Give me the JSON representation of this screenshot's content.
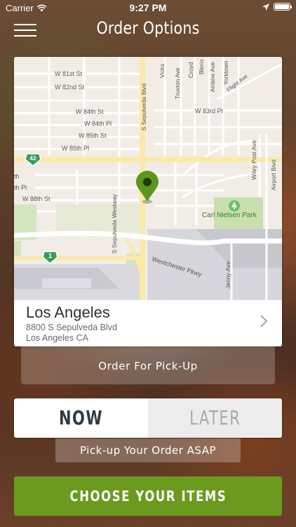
{
  "status_bar": {
    "carrier": "Carrier",
    "time": "9:27 PM"
  },
  "nav": {
    "title": "Order Options"
  },
  "map": {
    "streets": {
      "w81": "W 81st St",
      "w82": "W 82nd St",
      "w84": "W 84th St",
      "w84pl": "W 84th Pl",
      "w85": "W 85th St",
      "w85pl": "W 85th Pl",
      "w83pl": "W 83rd Pl",
      "w88": "W 88th St",
      "thpl": "th Pl",
      "th": "th",
      "sepulveda": "S Sepulveda Blvd",
      "sepulveda_westway": "S Sepulveda Westway",
      "westchester": "Westchester Pkwy",
      "vicks": "Vicks",
      "truxton": "Truxton Ave",
      "croyd": "Croyd",
      "blerio": "Blerio",
      "airlane": "Airlane Ave",
      "yorktown": "Yorktown",
      "flight": "Flight Ave",
      "wiley": "Wiley Post Ave",
      "airport": "Airport Blvd",
      "jenny": "Jenny Ave",
      "park": "Carl Nielsen Park"
    },
    "route_42": "42",
    "route_1": "1"
  },
  "location": {
    "name": "Los Angeles",
    "address_line1": "8800 S Sepulveda Blvd",
    "address_line2": "Los Angeles CA"
  },
  "order_type": "Order For Pick-Up",
  "timing": {
    "now": "NOW",
    "later": "LATER",
    "selected": "NOW"
  },
  "asap_message": "Pick-up Your Order ASAP",
  "cta": "CHOOSE YOUR ITEMS",
  "colors": {
    "accent_green": "#6b9a1f",
    "pin_green": "#5d961c",
    "park_green": "#c9dfae"
  }
}
